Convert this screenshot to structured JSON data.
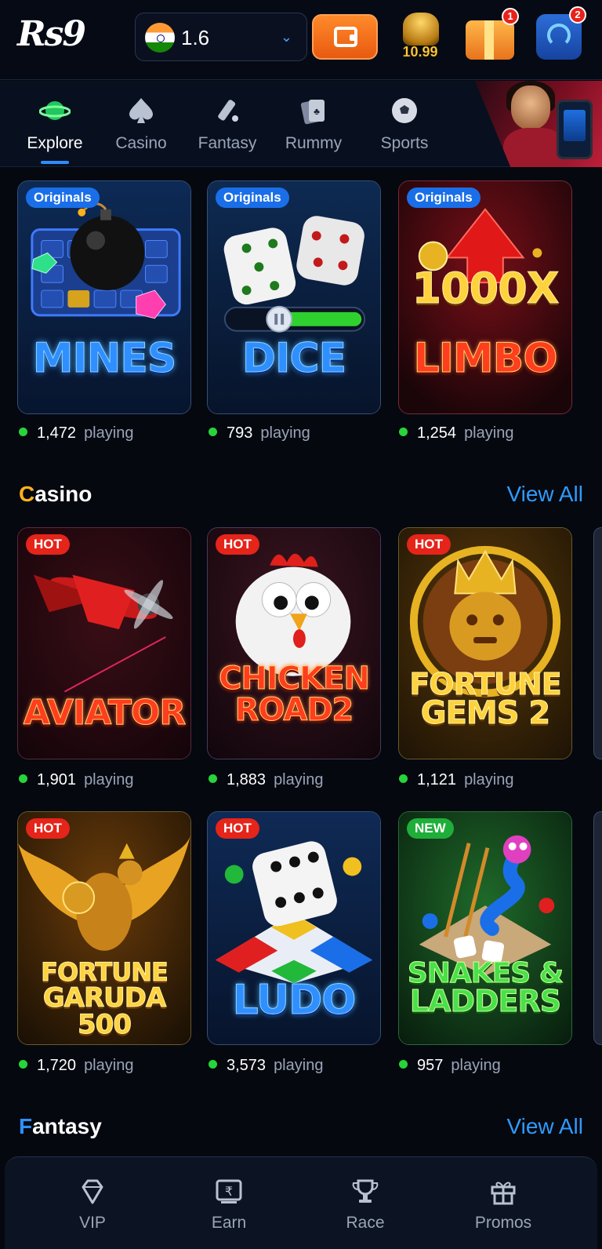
{
  "header": {
    "logo": "Rs9",
    "balance": "1.6",
    "jackpot_value": "10.99",
    "gift_badge": "1",
    "support_badge": "2"
  },
  "categories": [
    {
      "label": "Explore",
      "icon": "planet-icon",
      "active": true
    },
    {
      "label": "Casino",
      "icon": "spade-icon",
      "active": false
    },
    {
      "label": "Fantasy",
      "icon": "cricket-bat-icon",
      "active": false
    },
    {
      "label": "Rummy",
      "icon": "cards-icon",
      "active": false
    },
    {
      "label": "Sports",
      "icon": "football-icon",
      "active": false
    }
  ],
  "originals": [
    {
      "tag": "Originals",
      "title": "MINES",
      "playing": "1,472",
      "playing_word": "playing"
    },
    {
      "tag": "Originals",
      "title": "DICE",
      "playing": "793",
      "playing_word": "playing"
    },
    {
      "tag": "Originals",
      "title_top": "1000X",
      "title": "LIMBO",
      "playing": "1,254",
      "playing_word": "playing"
    }
  ],
  "casino": {
    "title_first": "C",
    "title_rest": "asino",
    "view_all": "View All",
    "games": [
      {
        "tag": "HOT",
        "title_line1": "AVIATOR",
        "title_line2": "",
        "playing": "1,901",
        "playing_word": "playing"
      },
      {
        "tag": "HOT",
        "title_line1": "CHICKEN",
        "title_line2": "ROAD2",
        "playing": "1,883",
        "playing_word": "playing"
      },
      {
        "tag": "HOT",
        "title_line1": "FORTUNE",
        "title_line2": "GEMS 2",
        "playing": "1,121",
        "playing_word": "playing"
      },
      {
        "tag": "HOT",
        "title_line1": "FORTUNE",
        "title_line2": "GARUDA 500",
        "playing": "1,720",
        "playing_word": "playing"
      },
      {
        "tag": "HOT",
        "title_line1": "LUDO",
        "title_line2": "",
        "playing": "3,573",
        "playing_word": "playing"
      },
      {
        "tag": "NEW",
        "title_line1": "SNAKES &",
        "title_line2": "LADDERS",
        "playing": "957",
        "playing_word": "playing"
      }
    ]
  },
  "fantasy": {
    "title_first": "F",
    "title_rest": "antasy",
    "view_all": "View All"
  },
  "bottom_nav": [
    {
      "label": "VIP",
      "icon": "diamond-icon"
    },
    {
      "label": "Earn",
      "icon": "rupee-screen-icon"
    },
    {
      "label": "Race",
      "icon": "trophy-icon"
    },
    {
      "label": "Promos",
      "icon": "gift-icon"
    }
  ],
  "colors": {
    "accent_blue": "#2f8fff",
    "casino_orange": "#ffb21a",
    "hot_red": "#e5241a",
    "new_green": "#1fae3a",
    "online_dot": "#27d43a"
  }
}
